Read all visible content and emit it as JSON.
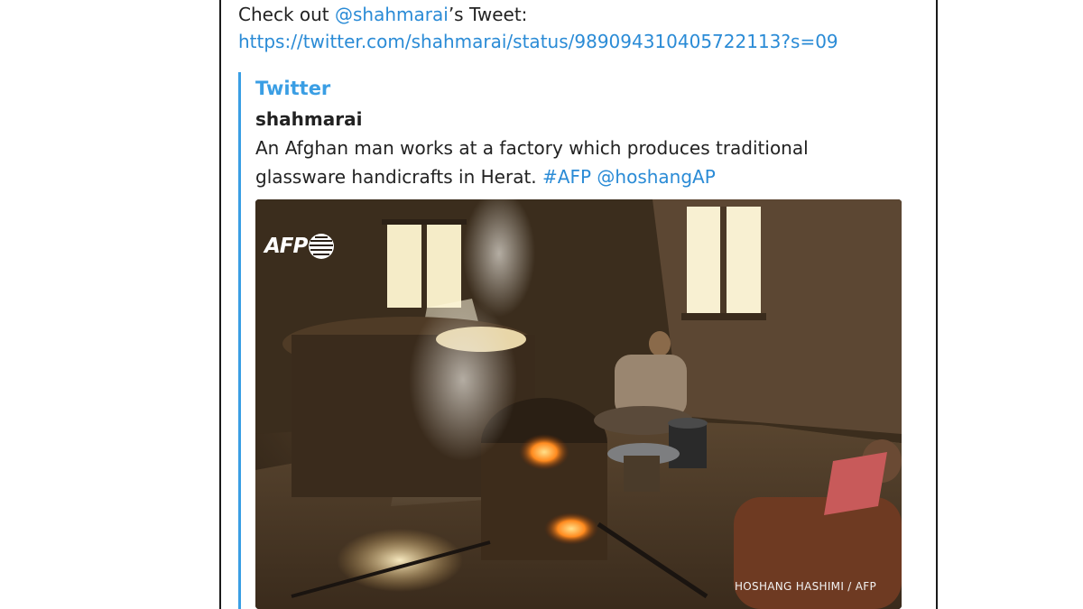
{
  "message": {
    "prefix": "Check out ",
    "mention": "@shahmarai",
    "suffix": "’s Tweet:",
    "url": "https://twitter.com/shahmarai/status/989094310405722113?s=09"
  },
  "link_preview": {
    "site_name": "Twitter",
    "title": "shahmarai",
    "description_text": "An Afghan man works at a factory which produces traditional glassware handicrafts in Herat. ",
    "hashtag": "#AFP",
    "handle": "@hoshangAP",
    "photo": {
      "watermark": "AFP",
      "credit": "HOSHANG HASHIMI  / AFP"
    }
  },
  "colors": {
    "link": "#2a8bd6",
    "accent_bar": "#3a9ee4",
    "text": "#222222"
  }
}
